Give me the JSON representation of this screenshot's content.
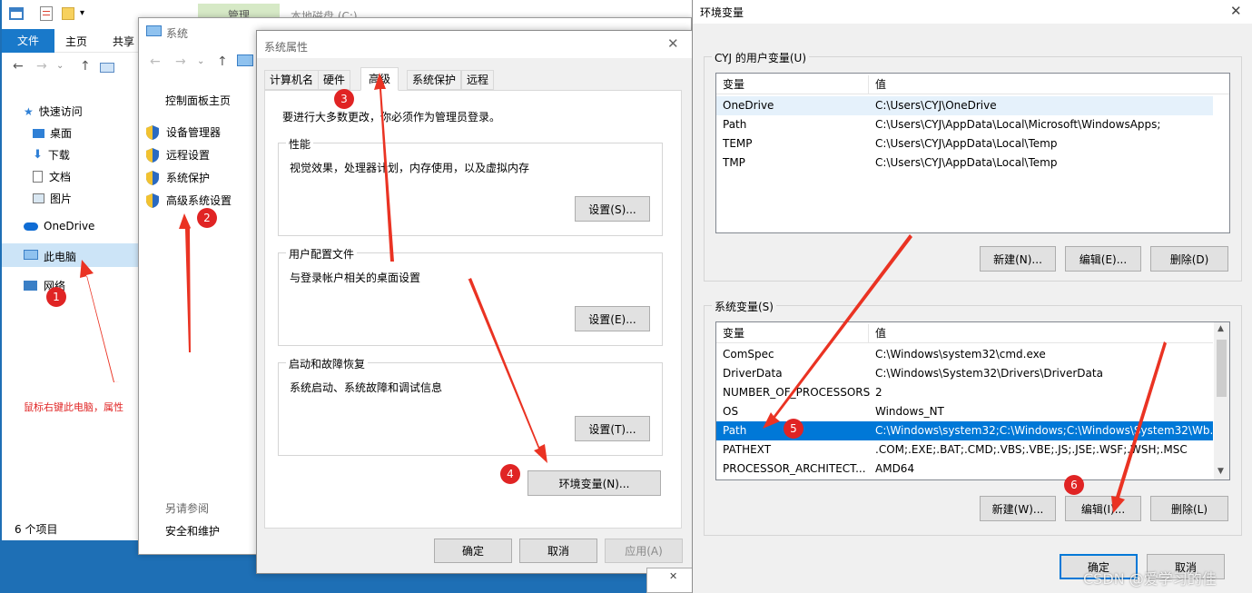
{
  "explorer": {
    "ribbon_tabs": [
      "文件",
      "主页",
      "共享"
    ],
    "context_tab": "管理",
    "drive_title": "本地磁盘 (C:)",
    "nav": [
      "快速访问",
      "桌面",
      "下载",
      "文档",
      "图片",
      "OneDrive",
      "此电脑",
      "网络"
    ],
    "status": "6 个项目",
    "annotation": "鼠标右键此电脑，属性"
  },
  "system": {
    "title": "系统",
    "home": "控制面板主页",
    "links": [
      "设备管理器",
      "远程设置",
      "系统保护",
      "高级系统设置"
    ],
    "see_also": "另请参阅",
    "security": "安全和维护"
  },
  "sysprops": {
    "title": "系统属性",
    "tabs": [
      "计算机名",
      "硬件",
      "高级",
      "系统保护",
      "远程"
    ],
    "admin_note": "要进行大多数更改，你必须作为管理员登录。",
    "perf_title": "性能",
    "perf_desc": "视觉效果，处理器计划，内存使用，以及虚拟内存",
    "settings_s": "设置(S)...",
    "profile_title": "用户配置文件",
    "profile_desc": "与登录帐户相关的桌面设置",
    "settings_e": "设置(E)...",
    "startup_title": "启动和故障恢复",
    "startup_desc": "系统启动、系统故障和调试信息",
    "settings_t": "设置(T)...",
    "env_button": "环境变量(N)...",
    "ok": "确定",
    "cancel": "取消",
    "apply": "应用(A)"
  },
  "env": {
    "title": "环境变量",
    "user_group": "CYJ 的用户变量(U)",
    "col_var": "变量",
    "col_val": "值",
    "user_vars": [
      {
        "name": "OneDrive",
        "value": "C:\\Users\\CYJ\\OneDrive"
      },
      {
        "name": "Path",
        "value": "C:\\Users\\CYJ\\AppData\\Local\\Microsoft\\WindowsApps;"
      },
      {
        "name": "TEMP",
        "value": "C:\\Users\\CYJ\\AppData\\Local\\Temp"
      },
      {
        "name": "TMP",
        "value": "C:\\Users\\CYJ\\AppData\\Local\\Temp"
      }
    ],
    "new_n": "新建(N)...",
    "edit_e": "编辑(E)...",
    "delete_d": "删除(D)",
    "sys_group": "系统变量(S)",
    "sys_vars": [
      {
        "name": "ComSpec",
        "value": "C:\\Windows\\system32\\cmd.exe"
      },
      {
        "name": "DriverData",
        "value": "C:\\Windows\\System32\\Drivers\\DriverData"
      },
      {
        "name": "NUMBER_OF_PROCESSORS",
        "value": "2"
      },
      {
        "name": "OS",
        "value": "Windows_NT"
      },
      {
        "name": "Path",
        "value": "C:\\Windows\\system32;C:\\Windows;C:\\Windows\\System32\\Wb..."
      },
      {
        "name": "PATHEXT",
        "value": ".COM;.EXE;.BAT;.CMD;.VBS;.VBE;.JS;.JSE;.WSF;.WSH;.MSC"
      },
      {
        "name": "PROCESSOR_ARCHITECT...",
        "value": "AMD64"
      }
    ],
    "new_w": "新建(W)...",
    "edit_i": "编辑(I)...",
    "delete_l": "删除(L)",
    "ok": "确定",
    "cancel": "取消"
  },
  "badges": [
    "1",
    "2",
    "3",
    "4",
    "5",
    "6"
  ],
  "watermark": "CSDN @爱学习的佳"
}
